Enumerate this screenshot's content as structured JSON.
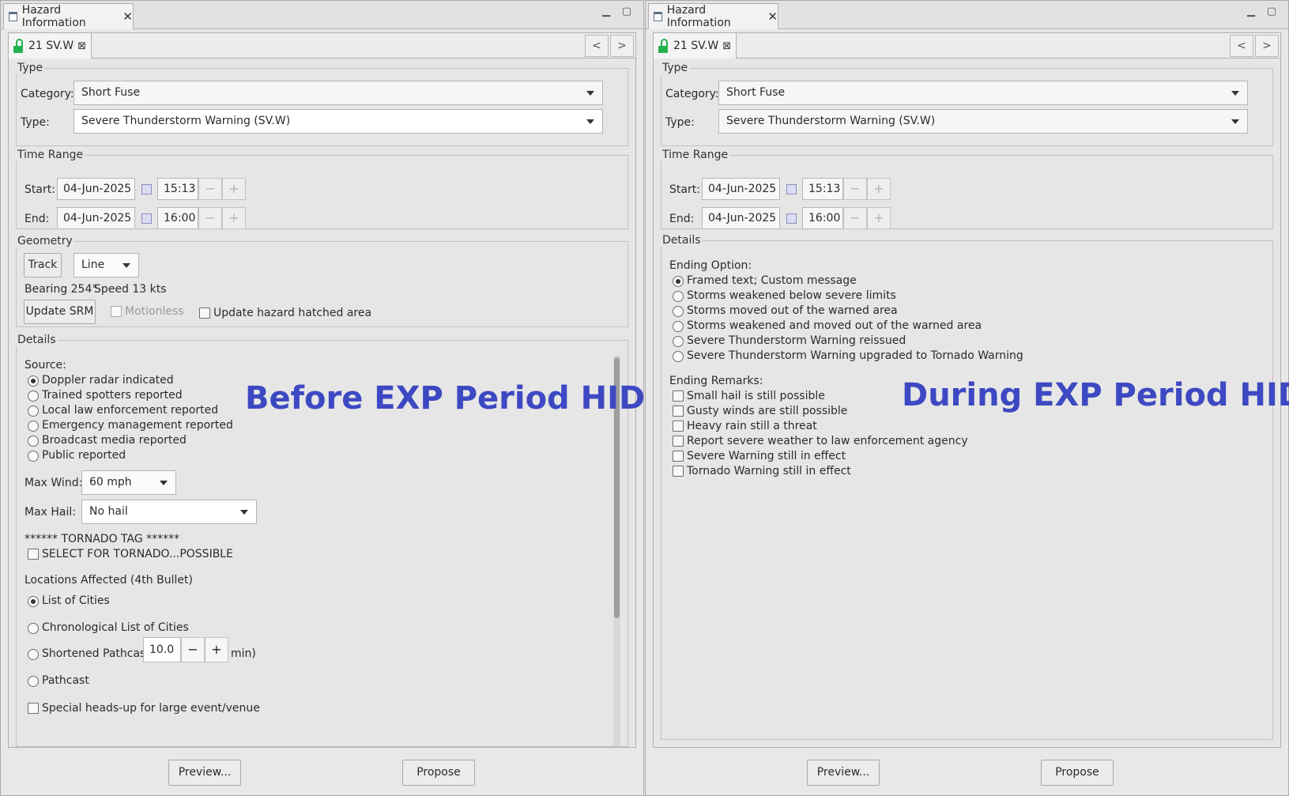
{
  "colors": {
    "annotation": "#3d49c2",
    "lock": "#23b14d"
  },
  "panels": [
    {
      "view_tab_title": "Hazard Information",
      "editor_tab_title": "21 SV.W",
      "nav_prev": "<",
      "nav_next": ">",
      "type_group": {
        "legend": "Type",
        "category_label": "Category:",
        "category_value": "Short Fuse",
        "type_label": "Type:",
        "type_value": "Severe Thunderstorm Warning (SV.W)"
      },
      "time_range": {
        "legend": "Time Range",
        "start_label": "Start:",
        "start_date": "04-Jun-2025",
        "start_time": "15:13",
        "end_label": "End:",
        "end_date": "04-Jun-2025",
        "end_time": "16:00",
        "minus": "−",
        "plus": "+"
      },
      "geometry": {
        "legend": "Geometry",
        "track_label": "Track",
        "line_value": "Line",
        "bearing": "Bearing 254°",
        "speed": "Speed 13 kts",
        "update_srm_label": "Update SRM",
        "motionless_label": "Motionless",
        "hatched_label": "Update hazard hatched area"
      },
      "details": {
        "legend": "Details",
        "source_label": "Source:",
        "sources": [
          "Doppler radar indicated",
          "Trained spotters reported",
          "Local law enforcement reported",
          "Emergency management reported",
          "Broadcast media reported",
          "Public reported"
        ],
        "max_wind_label": "Max Wind:",
        "max_wind_value": "60 mph",
        "max_hail_label": "Max Hail:",
        "max_hail_value": "No hail",
        "tornado_tag": "****** TORNADO TAG ******",
        "tornado_possible_label": "SELECT FOR TORNADO...POSSIBLE",
        "locations_label": "Locations Affected (4th Bullet)",
        "list_of_cities": "List of Cities",
        "chrono_list": "Chronological List of Cities",
        "shortened_pathcast": "Shortened Pathcast (",
        "pathcast_minutes": "10.0",
        "min_suffix": "min)",
        "pathcast": "Pathcast",
        "heads_up": "Special heads-up for large event/venue"
      },
      "annotation": "Before EXP Period HID",
      "preview_label": "Preview...",
      "propose_label": "Propose"
    },
    {
      "view_tab_title": "Hazard Information",
      "editor_tab_title": "21 SV.W",
      "nav_prev": "<",
      "nav_next": ">",
      "type_group": {
        "legend": "Type",
        "category_label": "Category:",
        "category_value": "Short Fuse",
        "type_label": "Type:",
        "type_value": "Severe Thunderstorm Warning (SV.W)"
      },
      "time_range": {
        "legend": "Time Range",
        "start_label": "Start:",
        "start_date": "04-Jun-2025",
        "start_time": "15:13",
        "end_label": "End:",
        "end_date": "04-Jun-2025",
        "end_time": "16:00",
        "minus": "−",
        "plus": "+"
      },
      "details": {
        "legend": "Details",
        "ending_option_label": "Ending Option:",
        "ending_options": [
          "Framed text; Custom message",
          "Storms weakened below severe limits",
          "Storms moved out of the warned area",
          "Storms weakened and moved out of the warned area",
          "Severe Thunderstorm Warning reissued",
          "Severe Thunderstorm Warning upgraded to Tornado Warning"
        ],
        "ending_remarks_label": "Ending Remarks:",
        "ending_remarks": [
          "Small hail is still possible",
          "Gusty winds are still possible",
          "Heavy rain still a threat",
          "Report severe weather to law enforcement agency",
          "Severe Warning still in effect",
          "Tornado Warning still in effect"
        ]
      },
      "annotation": "During EXP Period HID",
      "preview_label": "Preview...",
      "propose_label": "Propose"
    }
  ]
}
